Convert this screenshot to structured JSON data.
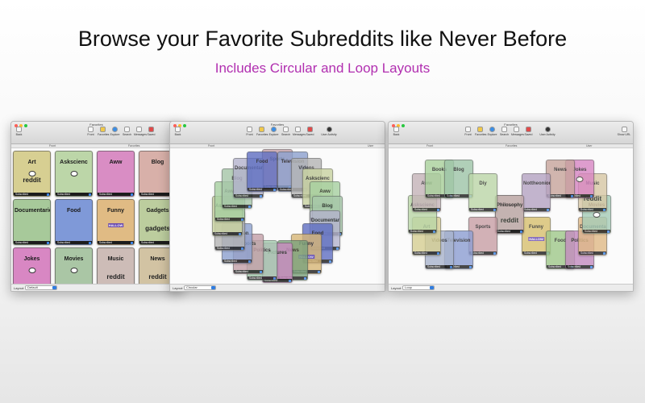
{
  "headline": "Browse your Favorite Subreddits like Never Before",
  "subheadline": "Includes Circular and Loop Layouts",
  "colors": {
    "accent": "#b12fb0",
    "subscribed_bar": "#1c1c1c",
    "select_arrow": "#2f7de1",
    "traffic_close": "#fe5f57",
    "traffic_min": "#febc2e",
    "traffic_max": "#28c840"
  },
  "toolbar": {
    "back": "Back",
    "front": "Front",
    "favorites": "Favorites",
    "explore": "Explore",
    "search": "Search",
    "messages": "Messages",
    "saved": "Saved",
    "user_activity": "User Activity",
    "show_url": "Show URL"
  },
  "windows": [
    {
      "title": "Favorites",
      "columns": [
        "Front",
        "Favorites"
      ],
      "layout_label": "Layout:",
      "layout_value": "Default"
    },
    {
      "title": "Favorites",
      "columns": [
        "Front",
        "User"
      ],
      "layout_label": "Layout:",
      "layout_value": "Circular"
    },
    {
      "title": "Favorites",
      "columns": [
        "Front",
        "Favorites",
        "User"
      ],
      "layout_label": "Layout:",
      "layout_value": "Loop"
    }
  ],
  "subscribed_label": "Subscribed",
  "grid_cards": [
    {
      "name": "Art",
      "color": "#d7cf92",
      "icon": "reddit-alien-icon",
      "logo": "reddit"
    },
    {
      "name": "Askscienc",
      "color": "#bcd6a8",
      "icon": "reddit-alien-icon"
    },
    {
      "name": "Aww",
      "color": "#d98dc4"
    },
    {
      "name": "Blog",
      "color": "#d8b0a9"
    },
    {
      "name": "Documentaries",
      "color": "#a7c99a"
    },
    {
      "name": "Food",
      "color": "#7f99d8"
    },
    {
      "name": "Funny",
      "color": "#e0bb84",
      "badge": "HALLOW"
    },
    {
      "name": "Gadgets",
      "color": "#bccd9e",
      "logo": "gadgets"
    },
    {
      "name": "Jokes",
      "color": "#d887c3",
      "icon": "reddit-alien-icon"
    },
    {
      "name": "Movies",
      "color": "#aac6a5",
      "icon": "reddit-alien-icon"
    },
    {
      "name": "Music",
      "color": "#cdbcb7",
      "logo": "reddit"
    },
    {
      "name": "News",
      "color": "#d2c3a3",
      "logo": "reddit"
    }
  ],
  "circular_cards": [
    {
      "name": "Sports",
      "color": "#c39fa8"
    },
    {
      "name": "Television",
      "color": "#8ca1cf"
    },
    {
      "name": "Videos",
      "color": "#b4b4b4"
    },
    {
      "name": "Askscienc",
      "color": "#c9d3a1"
    },
    {
      "name": "Aww",
      "color": "#a7d0a0"
    },
    {
      "name": "Blog",
      "color": "#a5c6a8"
    },
    {
      "name": "Documentaries",
      "color": "#b4b3cd"
    },
    {
      "name": "Food",
      "color": "#5f6fc2"
    },
    {
      "name": "Funny",
      "color": "#d8b777",
      "badge": "HALLOW"
    },
    {
      "name": "News",
      "color": "#7ba27c"
    },
    {
      "name": "Pictures",
      "color": "#c98bc0"
    },
    {
      "name": "Politics",
      "color": "#a6cdb0"
    }
  ],
  "loop_cards": [
    {
      "name": "Pictures",
      "color": "#8fb688"
    },
    {
      "name": "Funny",
      "color": "#d7c06f",
      "badge": "HALLOW"
    },
    {
      "name": "Food",
      "color": "#9fc88a"
    },
    {
      "name": "Politics",
      "color": "#c48bc0"
    },
    {
      "name": "Documentaries",
      "color": "#e0ba86"
    },
    {
      "name": "Movies",
      "color": "#a6ccb7",
      "icon": "reddit-alien-icon"
    },
    {
      "name": "Music",
      "color": "#d8c7a4",
      "logo": "reddit"
    },
    {
      "name": "Jokes",
      "color": "#d886c3",
      "icon": "reddit-alien-icon"
    },
    {
      "name": "News",
      "color": "#c7a49b"
    },
    {
      "name": "Nottheonion",
      "color": "#b5a3c2"
    },
    {
      "name": "Philosophy",
      "color": "#cdb0b6",
      "logo": "reddit"
    },
    {
      "name": "Sports",
      "color": "#c99fa6"
    },
    {
      "name": "Television",
      "color": "#8d9ed2"
    },
    {
      "name": "Videos",
      "color": "#a9b4cd"
    },
    {
      "name": "Art",
      "color": "#d6cf93"
    },
    {
      "name": "Askscienc",
      "color": "#b9d6a6"
    },
    {
      "name": "Aww",
      "color": "#c5b3b8"
    },
    {
      "name": "Books",
      "color": "#a9d19b"
    },
    {
      "name": "Blog",
      "color": "#9ec5a8"
    },
    {
      "name": "Diy",
      "color": "#bcd6a8"
    }
  ]
}
